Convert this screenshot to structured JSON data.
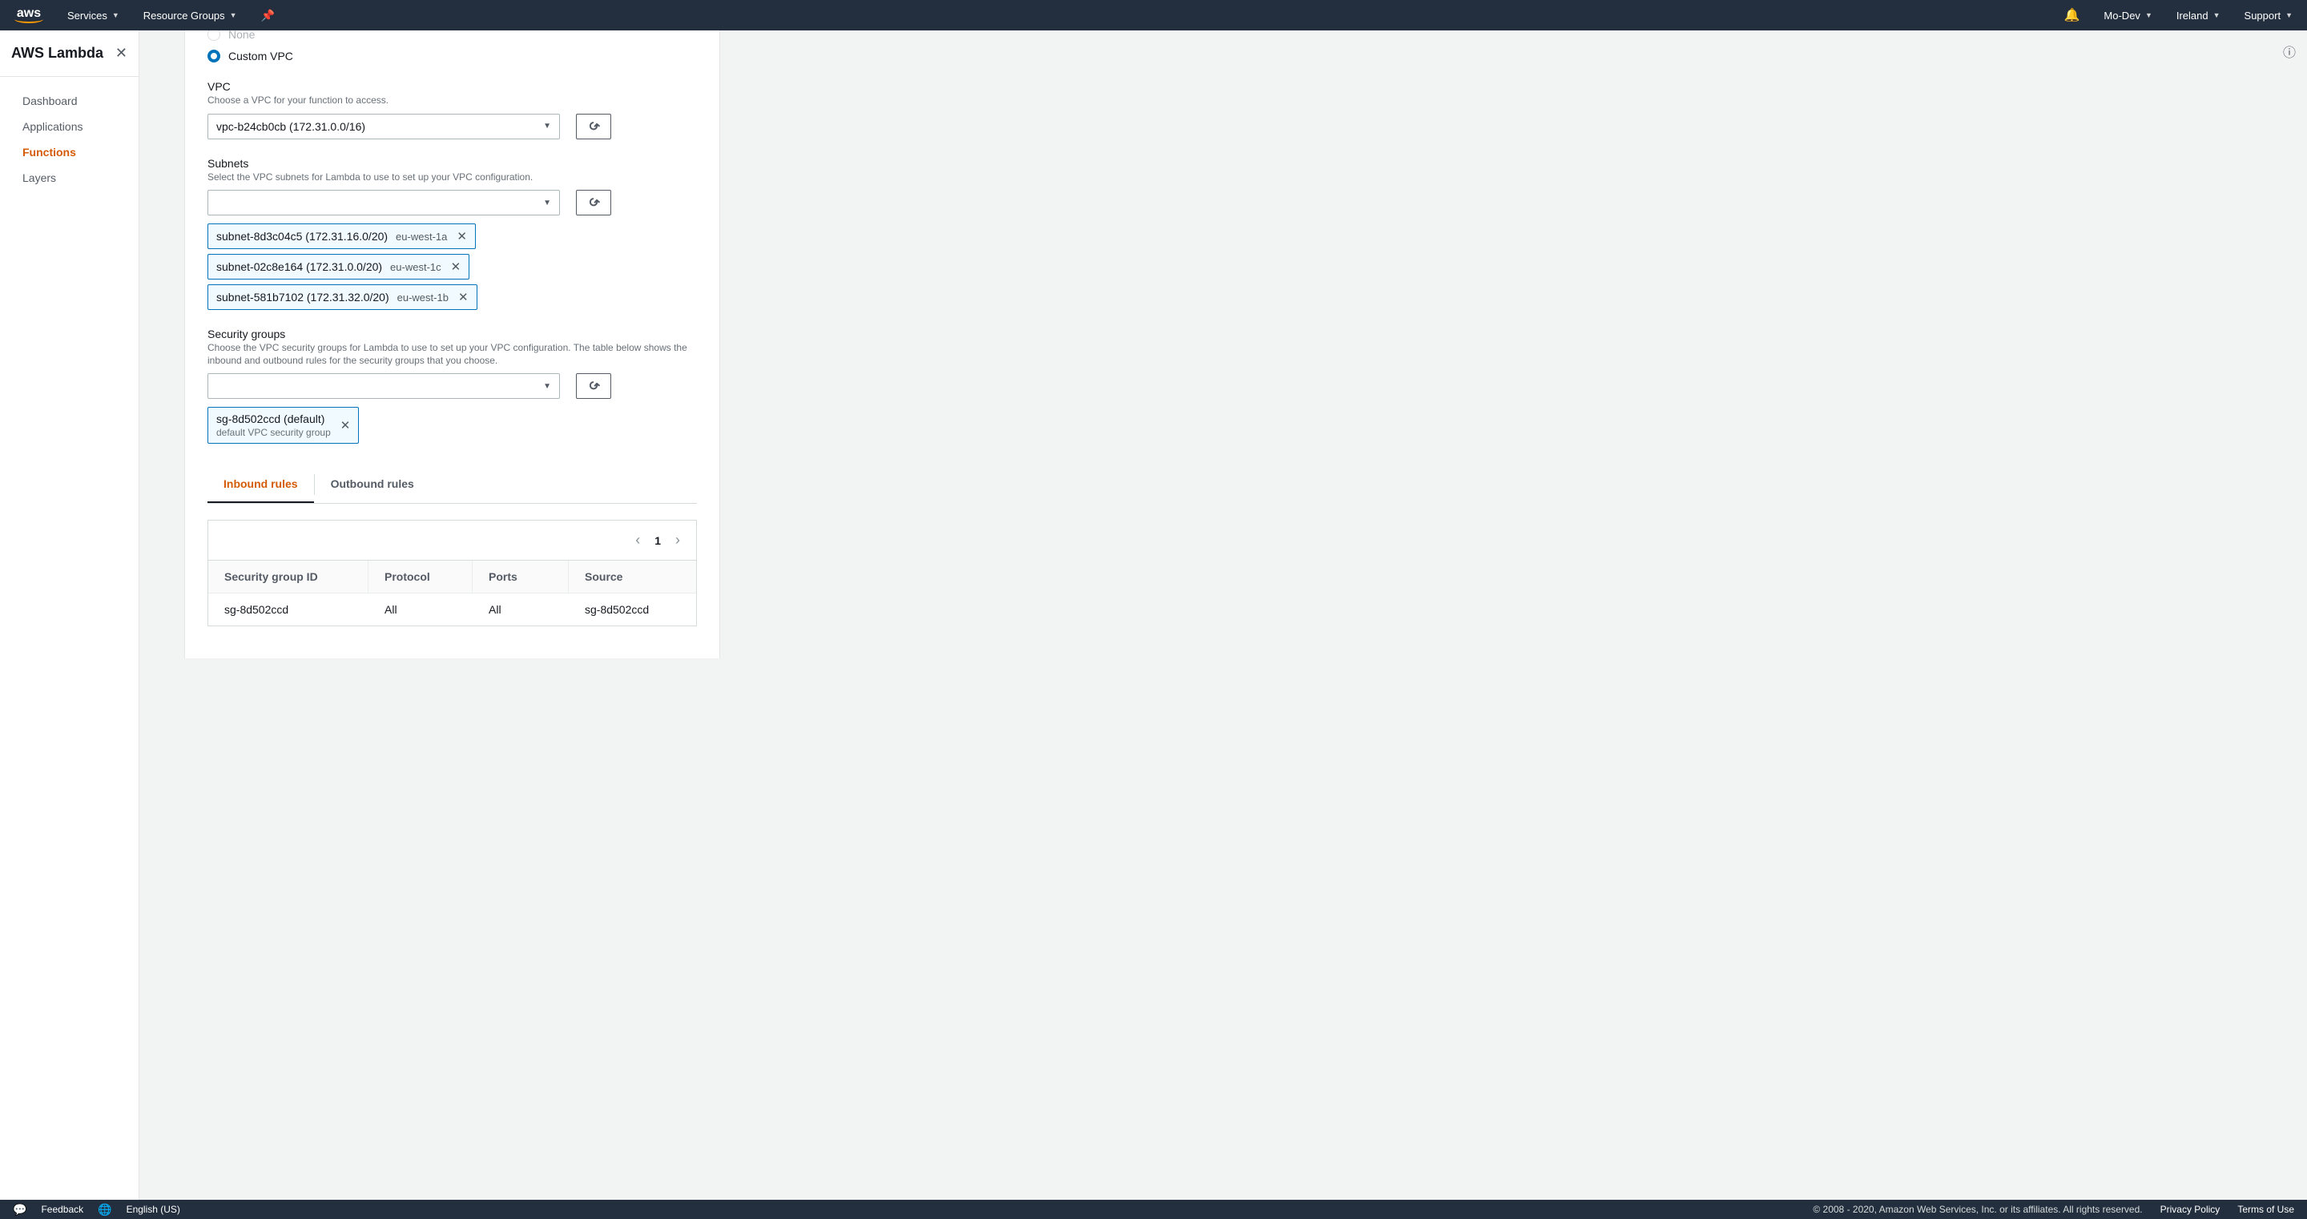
{
  "topnav": {
    "brand": "aws",
    "services": "Services",
    "resource_groups": "Resource Groups",
    "account": "Mo-Dev",
    "region": "Ireland",
    "support": "Support"
  },
  "sidebar": {
    "title": "AWS Lambda",
    "items": [
      {
        "label": "Dashboard",
        "active": false
      },
      {
        "label": "Applications",
        "active": false
      },
      {
        "label": "Functions",
        "active": true
      },
      {
        "label": "Layers",
        "active": false
      }
    ]
  },
  "vpcRadio": {
    "none": "None",
    "custom": "Custom VPC"
  },
  "vpc": {
    "label": "VPC",
    "help": "Choose a VPC for your function to access.",
    "value": "vpc-b24cb0cb (172.31.0.0/16)"
  },
  "subnets": {
    "label": "Subnets",
    "help": "Select the VPC subnets for Lambda to use to set up your VPC configuration.",
    "value": "",
    "chips": [
      {
        "id": "subnet-8d3c04c5 (172.31.16.0/20)",
        "az": "eu-west-1a"
      },
      {
        "id": "subnet-02c8e164 (172.31.0.0/20)",
        "az": "eu-west-1c"
      },
      {
        "id": "subnet-581b7102 (172.31.32.0/20)",
        "az": "eu-west-1b"
      }
    ]
  },
  "sg": {
    "label": "Security groups",
    "help": "Choose the VPC security groups for Lambda to use to set up your VPC configuration. The table below shows the inbound and outbound rules for the security groups that you choose.",
    "value": "",
    "chips": [
      {
        "id": "sg-8d502ccd (default)",
        "desc": "default VPC security group"
      }
    ]
  },
  "tabs": {
    "inbound": "Inbound rules",
    "outbound": "Outbound rules"
  },
  "table": {
    "page": "1",
    "headers": {
      "sg": "Security group ID",
      "proto": "Protocol",
      "ports": "Ports",
      "src": "Source"
    },
    "rows": [
      {
        "sg": "sg-8d502ccd",
        "proto": "All",
        "ports": "All",
        "src": "sg-8d502ccd"
      }
    ]
  },
  "footer": {
    "feedback": "Feedback",
    "language": "English (US)",
    "copyright": "© 2008 - 2020, Amazon Web Services, Inc. or its affiliates. All rights reserved.",
    "privacy": "Privacy Policy",
    "terms": "Terms of Use"
  }
}
